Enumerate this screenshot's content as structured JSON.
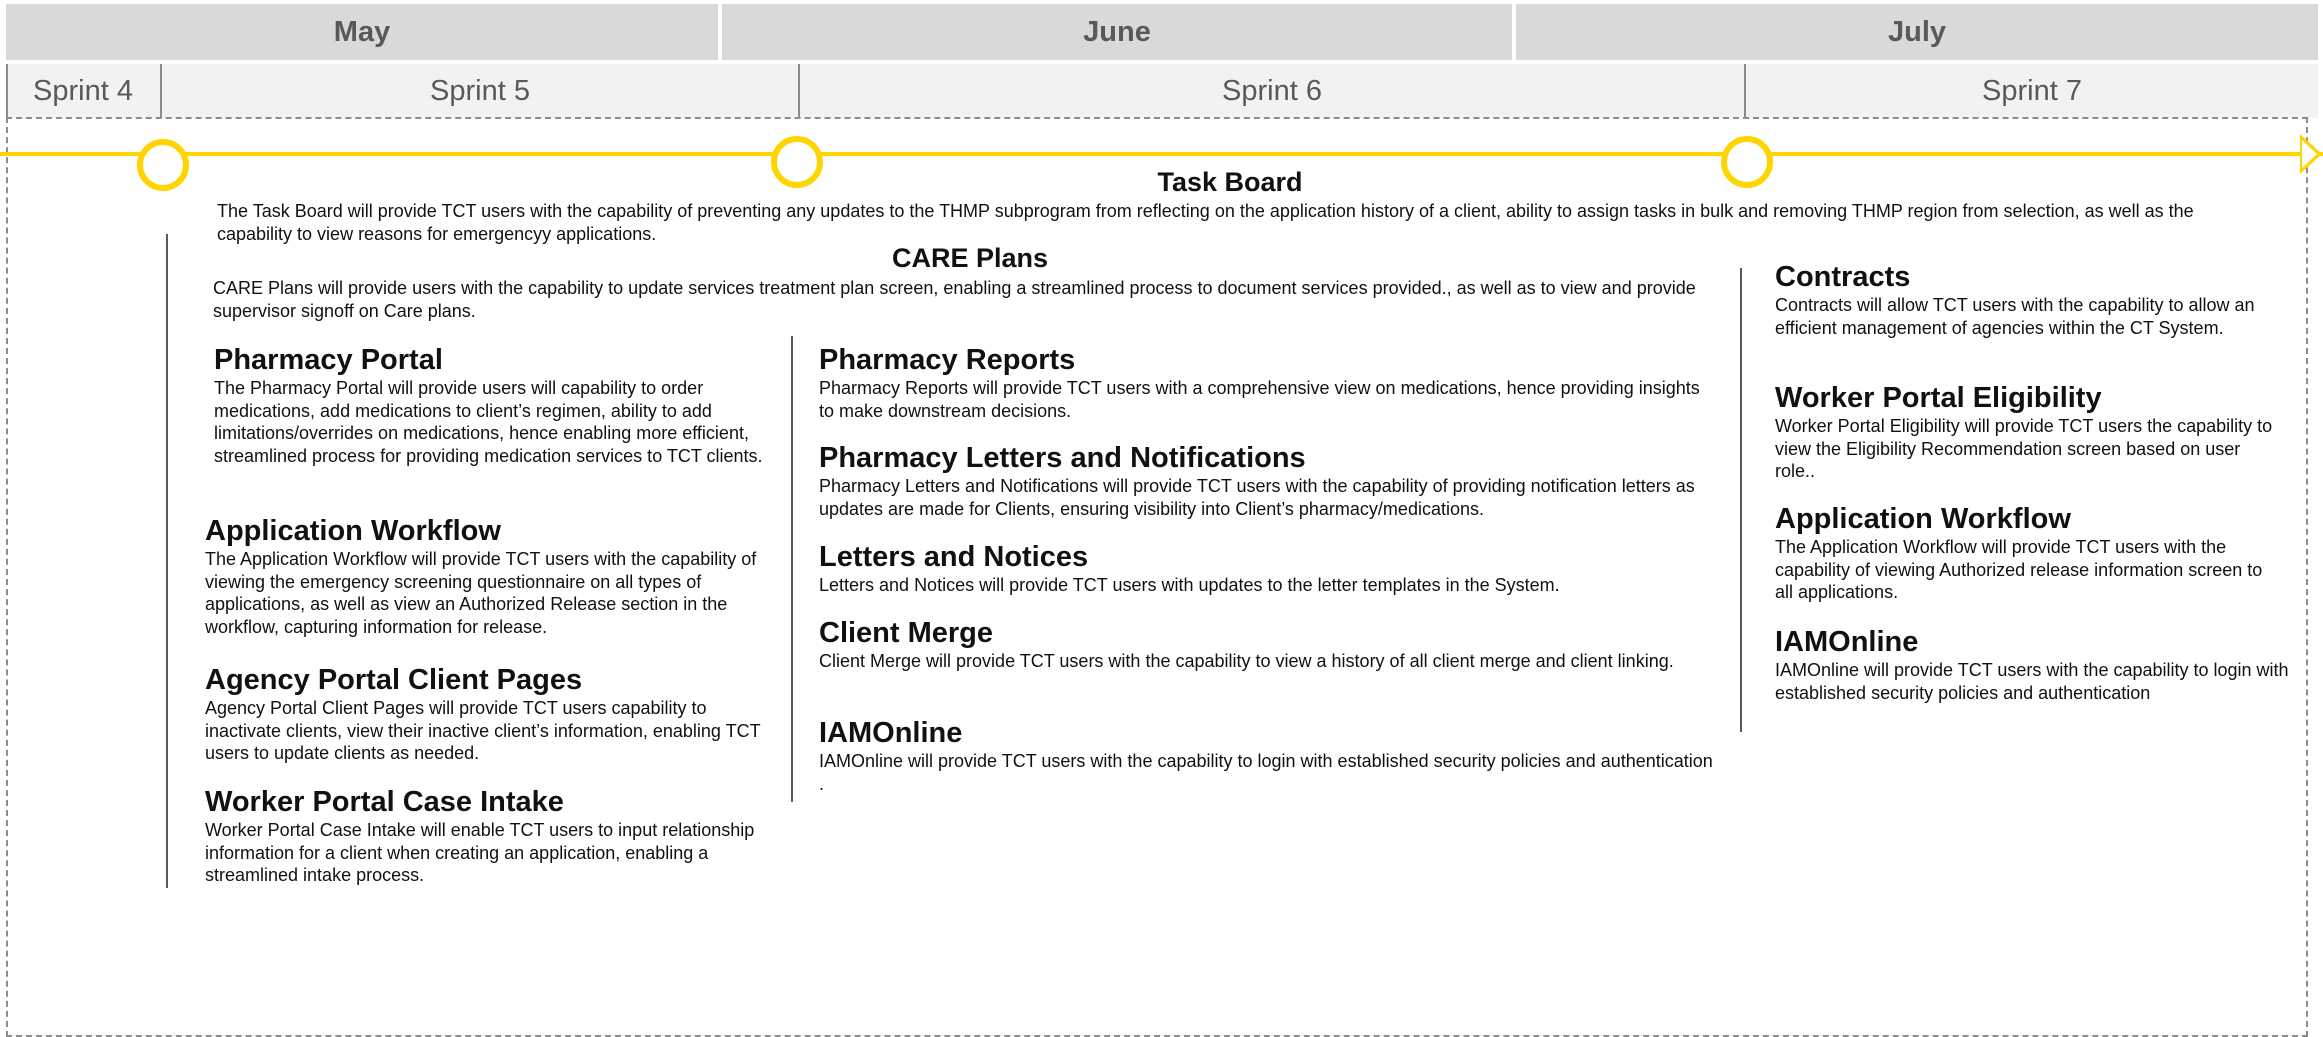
{
  "months": [
    "May",
    "June",
    "July"
  ],
  "sprints": [
    "Sprint 4",
    "Sprint 5",
    "Sprint 6",
    "Sprint 7"
  ],
  "colors": {
    "timeline": "#ffd400",
    "month_bg": "#d9d9d9",
    "sprint_bg": "#f2f2f2",
    "header_text": "#595959"
  },
  "task_board": {
    "title": "Task Board",
    "desc": "The Task Board will provide TCT users with the capability of preventing any updates to the THMP subprogram from reflecting on the application history of a client, ability to assign tasks in bulk and removing THMP region from selection, as well as the capability to view reasons for emergencyy applications."
  },
  "care_plans": {
    "title": "CARE Plans",
    "desc": "CARE Plans will provide users with the capability to update services treatment plan screen, enabling a streamlined process to document services provided., as well as to view and provide supervisor signoff on Care plans."
  },
  "col1": [
    {
      "title": "Pharmacy Portal",
      "desc": "The Pharmacy Portal will provide users will capability to order medications, add medications to client’s regimen, ability to add limitations/overrides on medications, hence enabling more efficient, streamlined process for providing medication services to TCT clients."
    },
    {
      "title": "Application Workflow",
      "desc": "The Application Workflow will provide TCT users with the capability of viewing the emergency screening questionnaire on all types of applications, as well as view an Authorized Release section in the workflow, capturing information for release."
    },
    {
      "title": "Agency Portal Client Pages",
      "desc": "Agency Portal Client Pages will provide TCT users capability to inactivate clients, view their inactive client’s information, enabling TCT users to update clients as needed."
    },
    {
      "title": "Worker Portal Case Intake",
      "desc": "Worker Portal Case Intake will enable TCT users to input relationship information for a client when creating an application, enabling a streamlined intake process."
    }
  ],
  "col2": [
    {
      "title": "Pharmacy Reports",
      "desc": "Pharmacy Reports will provide TCT users with a comprehensive view on medications, hence providing insights to make downstream decisions."
    },
    {
      "title": "Pharmacy Letters and Notifications",
      "desc": "Pharmacy Letters and Notifications will provide TCT users with the capability of providing notification letters as updates are made for Clients, ensuring visibility into Client’s pharmacy/medications."
    },
    {
      "title": "Letters and Notices",
      "desc": "Letters and Notices will provide TCT users with updates to the letter templates in the System."
    },
    {
      "title": "Client Merge",
      "desc": "Client Merge will provide TCT users with the capability to view a history of all client merge and client linking."
    },
    {
      "title": "IAMOnline",
      "desc": "IAMOnline will provide TCT users with the capability to login with established security policies and authentication ."
    }
  ],
  "col3": [
    {
      "title": "Contracts",
      "desc": "Contracts will allow TCT users with the capability to allow an efficient management of agencies within the CT System."
    },
    {
      "title": "Worker Portal Eligibility",
      "desc": "Worker Portal Eligibility will provide TCT users the capability to view the Eligibility Recommendation screen based on user role.."
    },
    {
      "title": "Application Workflow",
      "desc": "The Application Workflow will provide TCT users with the capability of viewing Authorized release information screen to all applications."
    },
    {
      "title": "IAMOnline",
      "desc": "IAMOnline will provide TCT users with the capability to login with established security policies and authentication"
    }
  ]
}
